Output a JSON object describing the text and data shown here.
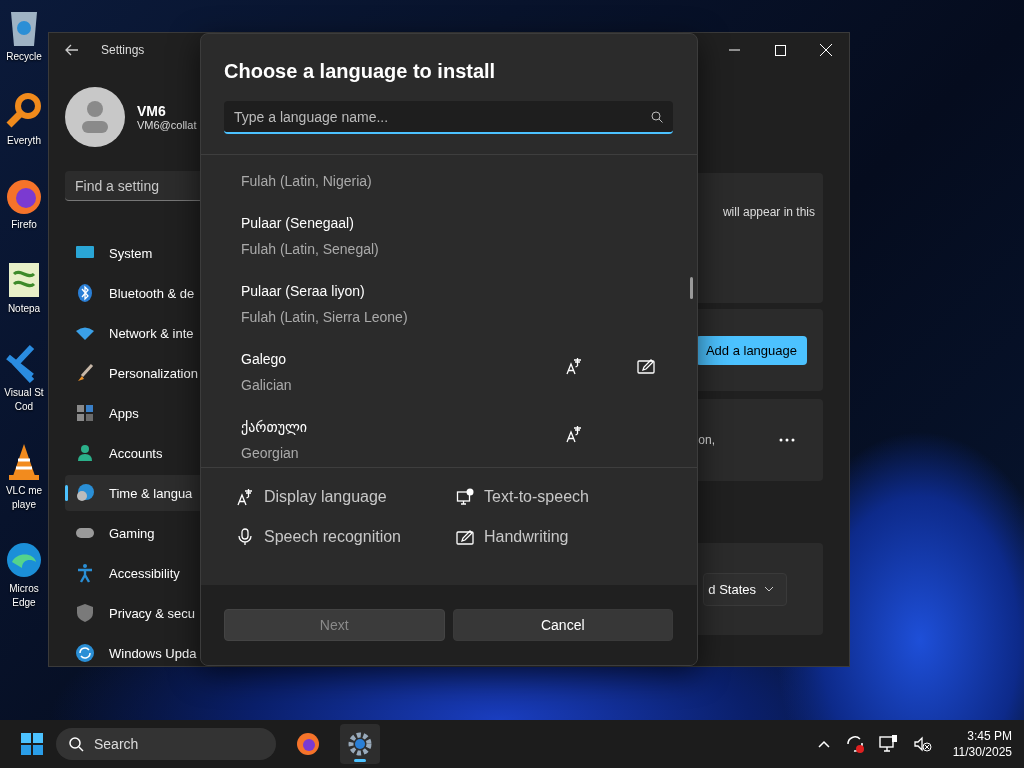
{
  "desktop_icons": [
    {
      "kind": "recycle-bin",
      "lines": [
        "Recycle"
      ]
    },
    {
      "kind": "search-app",
      "lines": [
        "Everyth"
      ]
    },
    {
      "kind": "browser",
      "lines": [
        "Firefo"
      ]
    },
    {
      "kind": "notepad",
      "lines": [
        "Notepa"
      ]
    },
    {
      "kind": "code-editor",
      "lines": [
        "Visual St",
        "Cod"
      ]
    },
    {
      "kind": "media-player",
      "lines": [
        "VLC me",
        "playe"
      ]
    },
    {
      "kind": "edge",
      "lines": [
        "Micros",
        "Edge"
      ]
    }
  ],
  "settings": {
    "title": "Settings",
    "account": {
      "name": "VM6",
      "email": "VM6@collat"
    },
    "search": {
      "placeholder": "Find a setting"
    },
    "nav": [
      {
        "kind": "system",
        "label": "System",
        "selected": false
      },
      {
        "kind": "bluetooth",
        "label": "Bluetooth & de",
        "selected": false
      },
      {
        "kind": "network",
        "label": "Network & inte",
        "selected": false
      },
      {
        "kind": "brush",
        "label": "Personalization",
        "selected": false
      },
      {
        "kind": "apps",
        "label": "Apps",
        "selected": false
      },
      {
        "kind": "accounts",
        "label": "Accounts",
        "selected": false
      },
      {
        "kind": "time",
        "label": "Time & langua",
        "selected": true
      },
      {
        "kind": "gaming",
        "label": "Gaming",
        "selected": false
      },
      {
        "kind": "accessibility",
        "label": "Accessibility",
        "selected": false
      },
      {
        "kind": "privacy",
        "label": "Privacy & secu",
        "selected": false
      },
      {
        "kind": "update",
        "label": "Windows Upda",
        "selected": false
      }
    ],
    "cards": [
      {
        "kind": "text",
        "text": "will appear in this"
      },
      {
        "kind": "button",
        "label": "Add a language"
      },
      {
        "kind": "more",
        "text": "on,"
      },
      {
        "kind": "dropdown",
        "value": "d States"
      }
    ]
  },
  "dialog": {
    "title": "Choose a language to install",
    "search": {
      "placeholder": "Type a language name..."
    },
    "languages": [
      {
        "sub": "Fulah (Latin, Nigeria)",
        "display_language": false,
        "handwriting": false
      },
      {
        "name": "Pulaar (Senegaal)",
        "sub": "Fulah (Latin, Senegal)",
        "display_language": false,
        "handwriting": false
      },
      {
        "name": "Pulaar (Seraa liyon)",
        "sub": "Fulah (Latin, Sierra Leone)",
        "display_language": false,
        "handwriting": false
      },
      {
        "name": "Galego",
        "sub": "Galician",
        "display_language": true,
        "handwriting": true
      },
      {
        "name": "ქართული",
        "sub": "Georgian",
        "display_language": true,
        "handwriting": false
      }
    ],
    "features": [
      {
        "kind": "display",
        "label": "Display language"
      },
      {
        "kind": "tts",
        "label": "Text-to-speech"
      },
      {
        "kind": "speech",
        "label": "Speech recognition"
      },
      {
        "kind": "handwriting",
        "label": "Handwriting"
      }
    ],
    "buttons": [
      {
        "label": "Next",
        "disabled": true
      },
      {
        "label": "Cancel",
        "disabled": false
      }
    ]
  },
  "taskbar": {
    "search": {
      "placeholder": "Search"
    },
    "apps": [
      {
        "kind": "browser",
        "active": false
      },
      {
        "kind": "settings",
        "active": true
      }
    ],
    "clock": {
      "time": "3:45 PM",
      "date": "11/30/2025"
    }
  }
}
